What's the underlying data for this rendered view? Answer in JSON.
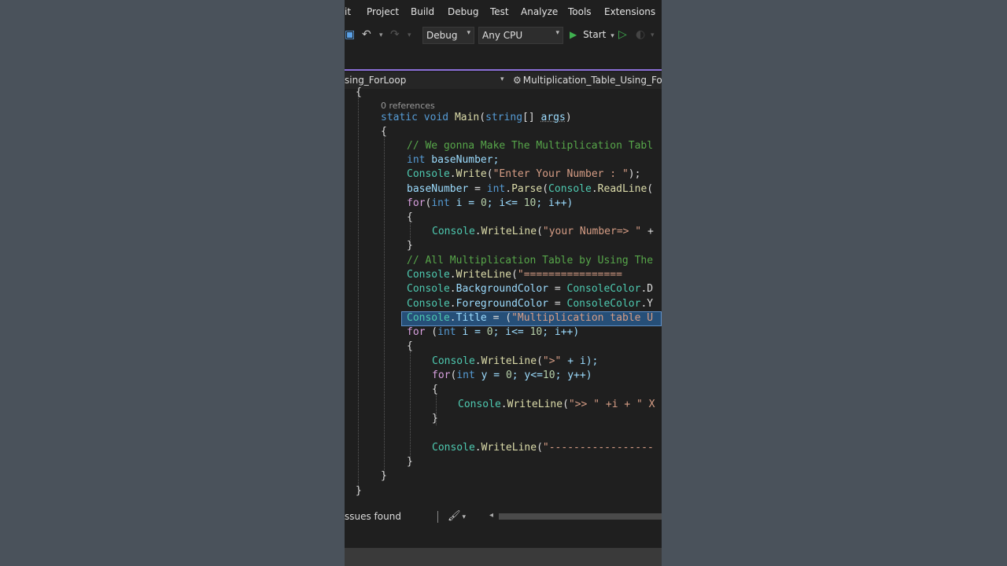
{
  "menu": {
    "edit_partial": "it",
    "project": "Project",
    "build": "Build",
    "debug": "Debug",
    "test": "Test",
    "analyze": "Analyze",
    "tools": "Tools",
    "extensions": "Extensions"
  },
  "toolbar": {
    "config": "Debug",
    "platform": "Any CPU",
    "start_label": "Start",
    "undo_icon": "undo-icon",
    "redo_icon": "redo-icon",
    "run_icon": "play-icon",
    "run_no_debug_icon": "play-outline-icon"
  },
  "navbar": {
    "left": "sing_ForLoop",
    "right": "Multiplication_Table_Using_ForLo"
  },
  "editor": {
    "codelens": "0 references",
    "lines": {
      "open_brace_class": "{",
      "main_static": "static",
      "main_void": "void",
      "main_name": "Main",
      "main_paren_open": "(",
      "main_string": "string",
      "main_brackets": "[] ",
      "main_args": "args",
      "main_paren_close": ")",
      "open_brace_main": "{",
      "comment1": "// We gonna Make The Multiplication Tabl",
      "decl_int": "int",
      "decl_name": " baseNumber;",
      "write_console": "Console",
      "write_dot": ".",
      "write_fn": "Write",
      "write_paren": "(",
      "write_str": "\"Enter Your Number : \"",
      "write_end": ");",
      "parse_lhs": "baseNumber",
      "parse_eq": " = ",
      "parse_int": "int",
      "parse_dot": ".",
      "parse_fn": "Parse",
      "parse_paren": "(",
      "parse_console": "Console",
      "parse_dot2": ".",
      "parse_readline": "ReadLine",
      "parse_paren2": "(",
      "for1_kw": "for",
      "for1_open": "(",
      "for1_int": "int",
      "for1_rest_a": " i = ",
      "for1_zero": "0",
      "for1_rest_b": "; i<= ",
      "for1_ten": "10",
      "for1_rest_c": "; i++)",
      "brace_open_for1": "{",
      "wl1_console": "Console",
      "wl1_dot": ".",
      "wl1_fn": "WriteLine",
      "wl1_paren": "(",
      "wl1_str": "\"your Number=> \"",
      "wl1_rest": " +",
      "brace_close_for1": "}",
      "comment2": "// All Multiplication Table by Using The",
      "wl2_console": "Console",
      "wl2_dot": ".",
      "wl2_fn": "WriteLine",
      "wl2_paren": "(",
      "wl2_str": "\"================",
      "bg_console": "Console",
      "bg_dot": ".",
      "bg_prop": "BackgroundColor",
      "bg_eq": " = ",
      "bg_cc": "ConsoleColor",
      "bg_tail": ".D",
      "fg_console": "Console",
      "fg_dot": ".",
      "fg_prop": "ForegroundColor",
      "fg_eq": " = ",
      "fg_cc": "ConsoleColor",
      "fg_tail": ".Y",
      "title_console": "Console",
      "title_dot": ".",
      "title_prop": "Title",
      "title_eq": " = (",
      "title_str": "\"Multiplication table U",
      "for2_kw": "for",
      "for2_open": " (",
      "for2_int": "int",
      "for2_rest_a": " i = ",
      "for2_zero": "0",
      "for2_rest_b": "; i<= ",
      "for2_ten": "10",
      "for2_rest_c": "; i++)",
      "brace_open_for2": "{",
      "wl3_console": "Console",
      "wl3_dot": ".",
      "wl3_fn": "WriteLine",
      "wl3_paren": "(",
      "wl3_str": "\">\"",
      "wl3_rest": " + i);",
      "for3_kw": "for",
      "for3_open": "(",
      "for3_int": "int",
      "for3_rest_a": " y = ",
      "for3_zero": "0",
      "for3_rest_b": "; y<=",
      "for3_ten": "10",
      "for3_rest_c": "; y++)",
      "brace_open_for3": "{",
      "wl4_console": "Console",
      "wl4_dot": ".",
      "wl4_fn": "WriteLine",
      "wl4_paren": "(",
      "wl4_str": "\">> \"",
      "wl4_rest": " +i + \" X",
      "brace_close_for3": "}",
      "wl5_console": "Console",
      "wl5_dot": ".",
      "wl5_fn": "WriteLine",
      "wl5_paren": "(",
      "wl5_str": "\"-----------------",
      "brace_close_for2": "}",
      "brace_close_main": "}",
      "brace_close_class": "}"
    }
  },
  "status": {
    "issues": "ssues found",
    "brush_icon": "cleanup-brush-icon"
  }
}
